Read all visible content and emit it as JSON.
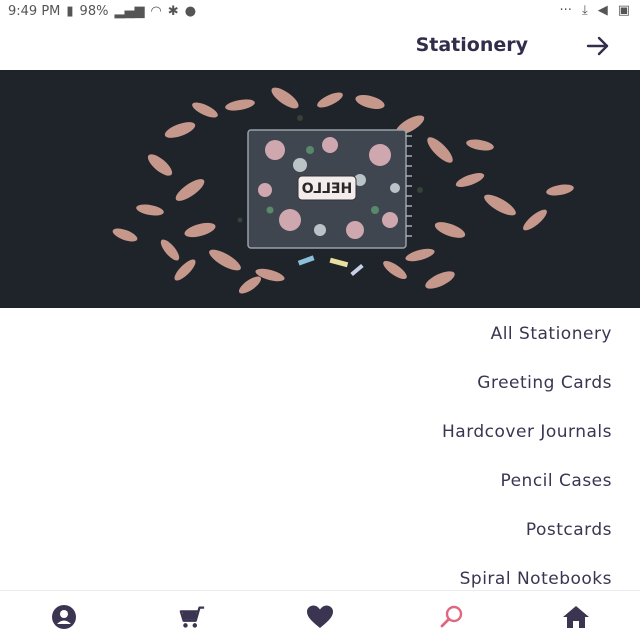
{
  "status_bar": {
    "time": "9:49 PM",
    "battery": "98%"
  },
  "header": {
    "title": "Stationery"
  },
  "hero": {
    "notebook_text": "HELLO"
  },
  "categories": [
    "All Stationery",
    "Greeting Cards",
    "Hardcover Journals",
    "Pencil Cases",
    "Postcards",
    "Spiral Notebooks"
  ],
  "bottom_nav": {
    "items": [
      {
        "icon": "home-icon",
        "active": false
      },
      {
        "icon": "search-icon",
        "active": true
      },
      {
        "icon": "heart-icon",
        "active": false
      },
      {
        "icon": "cart-icon",
        "active": false
      },
      {
        "icon": "account-icon",
        "active": false
      }
    ]
  },
  "colors": {
    "accent": "#e0677f",
    "primary": "#3b3552",
    "hero_bg": "#1f242b"
  }
}
